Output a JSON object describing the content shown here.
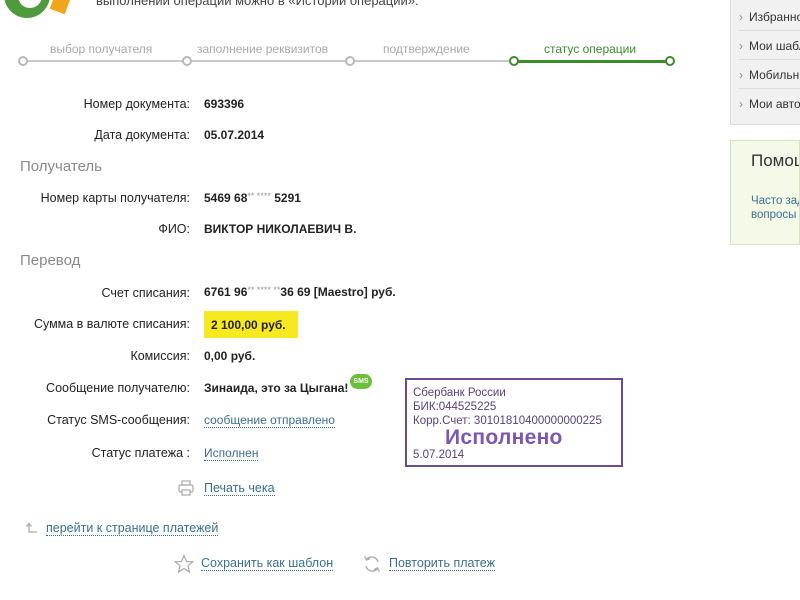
{
  "header": {
    "notice": "выполнении операции можно в «Истории операций»."
  },
  "steps": [
    {
      "label": "выбор получателя",
      "state": "done"
    },
    {
      "label": "заполнение реквизитов",
      "state": "done"
    },
    {
      "label": "подтверждение",
      "state": "done"
    },
    {
      "label": "статус операции",
      "state": "active"
    }
  ],
  "document": {
    "number_label": "Номер документа:",
    "number_value": "693396",
    "date_label": "Дата документа:",
    "date_value": "05.07.2014"
  },
  "recipient": {
    "section_title": "Получатель",
    "card_label": "Номер карты получателя:",
    "card_prefix": "5469 68",
    "card_mask": "** ****",
    "card_suffix": " 5291",
    "name_label": "ФИО:",
    "name_value": "ВИКТОР НИКОЛАЕВИЧ В."
  },
  "transfer": {
    "section_title": "Перевод",
    "account_label": "Счет списания:",
    "account_prefix": "6761 96",
    "account_mask": "** **** **",
    "account_suffix": "36 69  [Maestro]  руб.",
    "amount_label": "Сумма в валюте списания:",
    "amount_value": "2 100,00  руб.",
    "fee_label": "Комиссия:",
    "fee_value": "0,00 руб.",
    "message_label": "Сообщение получателю:",
    "message_value": "Зинаида, это за Цыгана!",
    "sms_badge": "SMS",
    "sms_status_label": "Статус SMS-сообщения:",
    "sms_status_value": "сообщение отправлено",
    "payment_status_label": "Статус платежа :",
    "payment_status_value": "Исполнен"
  },
  "stamp": {
    "bank": "Сбербанк России",
    "bik": "БИК:044525225",
    "corr": "Корр.Счет: 30101810400000000225",
    "status": "Исполнено",
    "date": "5.07.2014"
  },
  "actions": {
    "print": "Печать чека",
    "back": "перейти к странице платежей",
    "save_template": "Сохранить как шаблон",
    "repeat": "Повторить платеж"
  },
  "sidebar": {
    "items": [
      "Избранное",
      "Мои шаблоны",
      "Мобильный банк",
      "Мои автоплатежи"
    ],
    "help_title": "Помощь",
    "help_link_1": "Часто задаваемые",
    "help_link_2": "вопросы"
  },
  "colors": {
    "accent_green": "#3e8d2c",
    "highlight_yellow": "#f7e91f",
    "link_blue": "#3b6f8f",
    "stamp_purple": "#6b4c8a"
  }
}
